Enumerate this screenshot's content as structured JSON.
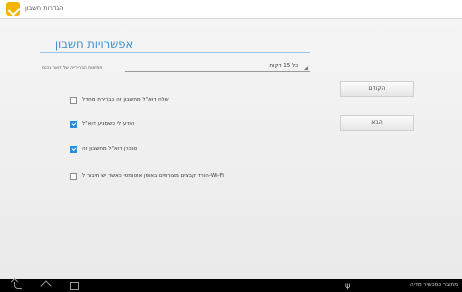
{
  "titlebar": {
    "icon": "account-settings-icon",
    "title": "הגדרות חשבון"
  },
  "page": {
    "heading": "אפשרויות חשבון",
    "accent_color": "#3a8bd0"
  },
  "signature_setting": {
    "label": "חתימות הברירייה של דואר נכנס",
    "value": "כל 15 דקות"
  },
  "options": [
    {
      "label": "שלח דוא\"ל מחשבון זה כברירת מחדל",
      "checked": false
    },
    {
      "label": "הודע לי כשמגיע דוא\"ל",
      "checked": true
    },
    {
      "label": "סנכרן דוא\"ל מחשבון זה",
      "checked": true
    },
    {
      "label": "הורד קבצים מצורפים באופן אוטומטי כאשר יש חיבור ל-Wi-Fi",
      "checked": false
    }
  ],
  "buttons": {
    "previous": "הקודם",
    "next": "הבא"
  },
  "navbar": {
    "back_icon": "back-icon",
    "home_icon": "home-icon",
    "recents_icon": "recents-icon",
    "usb_icon": "usb-icon",
    "status_text": "מחובר כמכשיר מדיה"
  }
}
